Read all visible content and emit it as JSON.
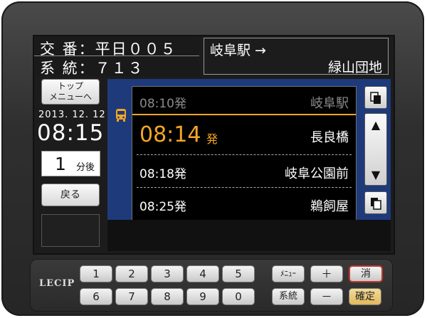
{
  "header": {
    "route_label": "交 番：平日００５",
    "system_label": "系 統：７１３"
  },
  "destination": {
    "from": "岐阜駅 →",
    "to": "緑山団地"
  },
  "left_panel": {
    "top_menu_button": [
      "トップ",
      "メニューへ"
    ],
    "date": "2013. 12. 12",
    "time": "08:15",
    "minutes_value": "1",
    "minutes_unit": "分後",
    "back_button": "戻る"
  },
  "schedule": {
    "rows": [
      {
        "time": "08:10発",
        "stop": "岐阜駅",
        "state": "past"
      },
      {
        "time": "08:14",
        "suffix": "発",
        "stop": "長良橋",
        "state": "current"
      },
      {
        "time": "08:18発",
        "stop": "岐阜公園前",
        "state": "upcoming"
      },
      {
        "time": "08:25発",
        "stop": "鵜飼屋",
        "state": "upcoming"
      }
    ]
  },
  "icons": {
    "bus": "bus-icon",
    "page_top": "page-top-icon",
    "scroll_up": "▲",
    "scroll_down": "▼",
    "page_bottom": "page-bottom-icon"
  },
  "keypad": {
    "logo": "LECIP",
    "digits_top": [
      "1",
      "2",
      "3",
      "4",
      "5"
    ],
    "digits_bottom": [
      "6",
      "7",
      "8",
      "9",
      "0"
    ],
    "menu_key": "ﾒﾆｭｰ",
    "system_key": "系統",
    "plus_key": "＋",
    "minus_key": "－",
    "clear_key": "消",
    "confirm_key": "確定"
  },
  "colors": {
    "accent_orange": "#f5a623",
    "list_panel_blue": "#1e3a7a",
    "past_text": "#8a8a8a",
    "clear_key_border": "#c0392b",
    "confirm_key_bg": "#e8c870"
  }
}
